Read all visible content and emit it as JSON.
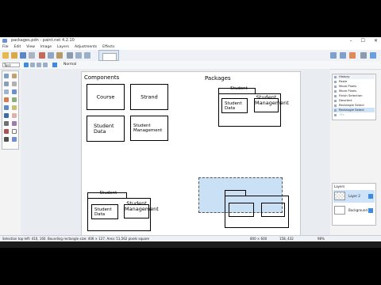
{
  "app": {
    "title": "packages.pdn - paint.net 4.2.10",
    "menu": [
      "File",
      "Edit",
      "View",
      "Image",
      "Layers",
      "Adjustments",
      "Effects"
    ]
  },
  "toolbar": {
    "tool_label": "Tool:  ",
    "blend_mode": "Normal"
  },
  "canvas": {
    "heading_components": "Components",
    "heading_packages": "Packages",
    "boxes": {
      "course": "Course",
      "strand": "Strand",
      "student_data": "Student Data",
      "student_management": "Student Management"
    },
    "pkg_top": {
      "tab": "Student",
      "data": "Student Data",
      "mgmt": "Student Management"
    },
    "pkg_bottom": {
      "tab": "Student",
      "data": "Student Data",
      "mgmt": "Student Management"
    }
  },
  "history": {
    "title": "History",
    "items": [
      "Paste",
      "Move Pixels",
      "Move Pixels",
      "Finish Selection",
      "Deselect",
      "Rectangle Select",
      "Rectangle Select",
      " Pix"
    ]
  },
  "layers": {
    "title": "Layers",
    "items": [
      "Layer 2",
      "Background"
    ]
  },
  "status": {
    "hint": "Selection top left: 410, 160. Bounding rectangle size: 406 × 127. Area: 51,562 pixels square",
    "size": "800 × 600",
    "pos": "158, 432",
    "zoom": "98%"
  },
  "colors": {
    "selection_fill": "#c9e0f5",
    "accent": "#3d8be0"
  }
}
